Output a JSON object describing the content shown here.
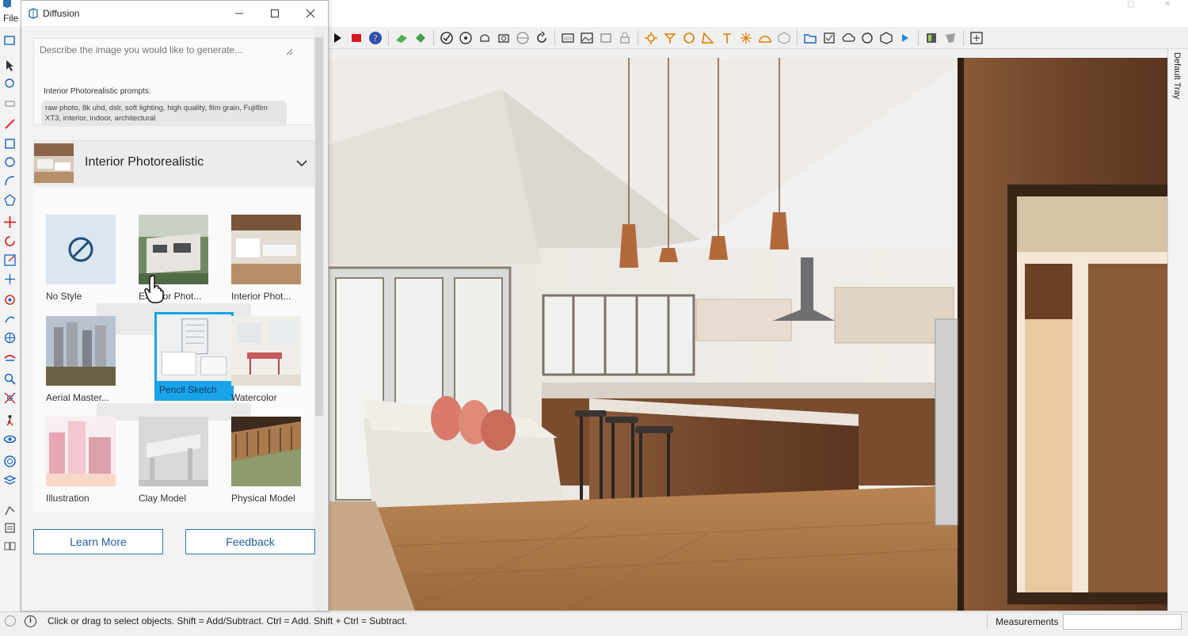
{
  "host": {
    "menu_file": "File",
    "status_text": "Click or drag to select objects. Shift = Add/Subtract. Ctrl = Add. Shift + Ctrl = Subtract.",
    "measurements_label": "Measurements",
    "tray_label": "Default Tray"
  },
  "diffusion": {
    "title": "Diffusion",
    "prompt_placeholder": "Describe the image you would like to generate...",
    "prompts_heading": "Interior Photorealistic prompts:",
    "prompts_chip": "raw photo, 8k uhd, dslr, soft lighting, high quality, film grain, Fujifilm XT3, interior, indoor, architectural",
    "selected_style": "Interior Photorealistic",
    "styles": [
      {
        "label": "No Style",
        "icon": "no-style-icon"
      },
      {
        "label": "Exterior Phot...",
        "icon": "exterior-photo"
      },
      {
        "label": "Interior Phot...",
        "icon": "interior-photo"
      },
      {
        "label": "Aerial Master...",
        "icon": "aerial-masterplan"
      },
      {
        "label": "Pencil Sketch",
        "icon": "pencil-sketch",
        "selected": true
      },
      {
        "label": "Watercolor",
        "icon": "watercolor"
      },
      {
        "label": "Illustration",
        "icon": "illustration"
      },
      {
        "label": "Clay Model",
        "icon": "clay-model"
      },
      {
        "label": "Physical Model",
        "icon": "physical-model"
      }
    ],
    "learn_more_label": "Learn More",
    "feedback_label": "Feedback"
  },
  "colors": {
    "accent": "#1aa3e8",
    "button_border": "#2d74b8"
  }
}
